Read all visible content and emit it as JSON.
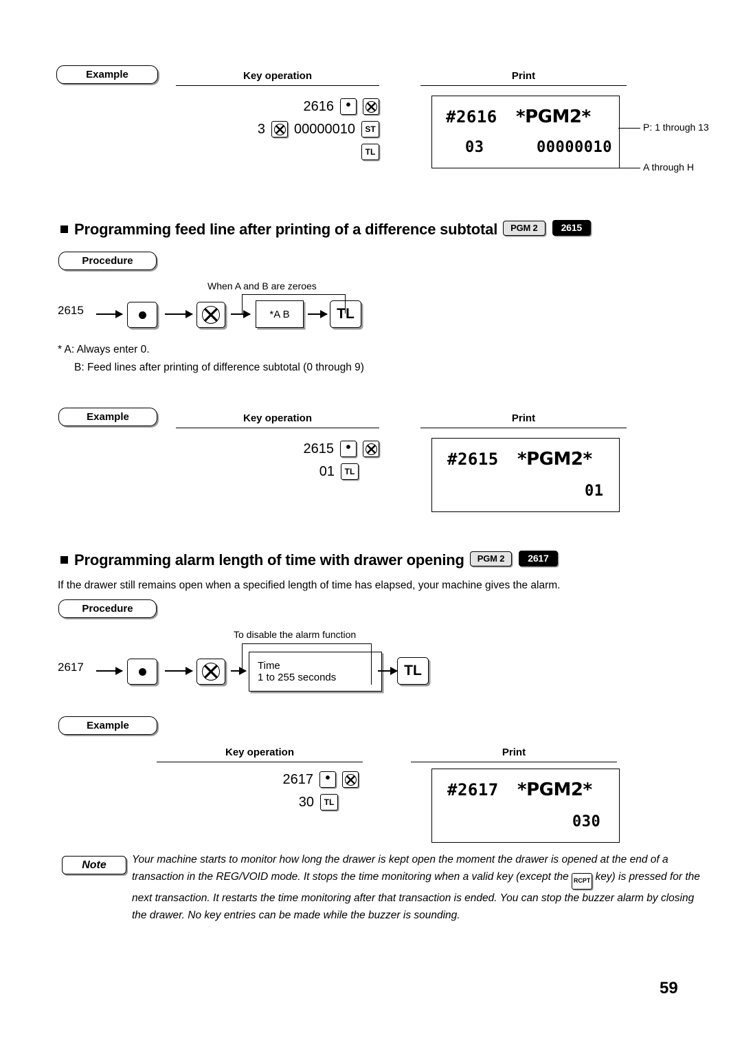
{
  "page": {
    "number": "59"
  },
  "block1": {
    "example_label": "Example",
    "key_operation_label": "Key operation",
    "print_label": "Print",
    "line1_value": "2616",
    "line1_keys": [
      "dot-key",
      "multiply-key"
    ],
    "line2_qty": "3",
    "line2_key_multiply": "multiply-key",
    "line2_value": "00000010",
    "line2_key_st": "ST",
    "line3_key_tl": "TL",
    "receipt": {
      "line1_left": "#2616",
      "line1_right": "*PGM2*",
      "line2_left": "03",
      "line2_right": "00000010"
    },
    "callout_top": "P: 1 through 13",
    "callout_bottom": "A through H"
  },
  "section1": {
    "title": "Programming feed line after printing of a difference subtotal",
    "tag_mode": "PGM 2",
    "tag_code": "2615",
    "procedure_label": "Procedure",
    "flow": {
      "code": "2615",
      "caption": "When A and B are zeroes",
      "data_box": "*A B",
      "dot_key": "dot-key",
      "multiply_key": "multiply-key",
      "tl_key": "TL"
    },
    "notes": [
      "*  A:  Always enter 0.",
      "B:  Feed lines after printing of difference subtotal (0 through 9)"
    ],
    "example": {
      "example_label": "Example",
      "key_operation_label": "Key operation",
      "print_label": "Print",
      "line1_value": "2615",
      "line2_value": "01",
      "line2_key_tl": "TL",
      "receipt": {
        "line1_left": "#2615",
        "line1_right": "*PGM2*",
        "line2_right": "01"
      }
    }
  },
  "section2": {
    "title": "Programming alarm length of time with drawer opening",
    "tag_mode": "PGM 2",
    "tag_code": "2617",
    "intro": "If the drawer still remains open when a specified length of time has elapsed, your machine gives the alarm.",
    "procedure_label": "Procedure",
    "flow": {
      "code": "2617",
      "caption": "To disable the alarm function",
      "data_box_line1": "Time",
      "data_box_line2": "1 to 255 seconds",
      "dot_key": "dot-key",
      "multiply_key": "multiply-key",
      "tl_key": "TL"
    },
    "example": {
      "example_label": "Example",
      "key_operation_label": "Key operation",
      "print_label": "Print",
      "line1_value": "2617",
      "line2_value": "30",
      "line2_key_tl": "TL",
      "receipt": {
        "line1_left": "#2617",
        "line1_right": "*PGM2*",
        "line2_right": "030"
      }
    }
  },
  "note": {
    "label": "Note",
    "text_part1": "Your machine starts to monitor how long the drawer is kept open the moment the drawer is opened at the end of a transaction in the REG/VOID mode. It stops the time monitoring when a valid key (except the",
    "rcpt_key": "RCPT",
    "text_part2": "key) is pressed for the next transaction. It restarts the time monitoring after that transaction is ended. You can stop the buzzer alarm by closing the drawer. No key entries can be made while the buzzer is sounding."
  }
}
